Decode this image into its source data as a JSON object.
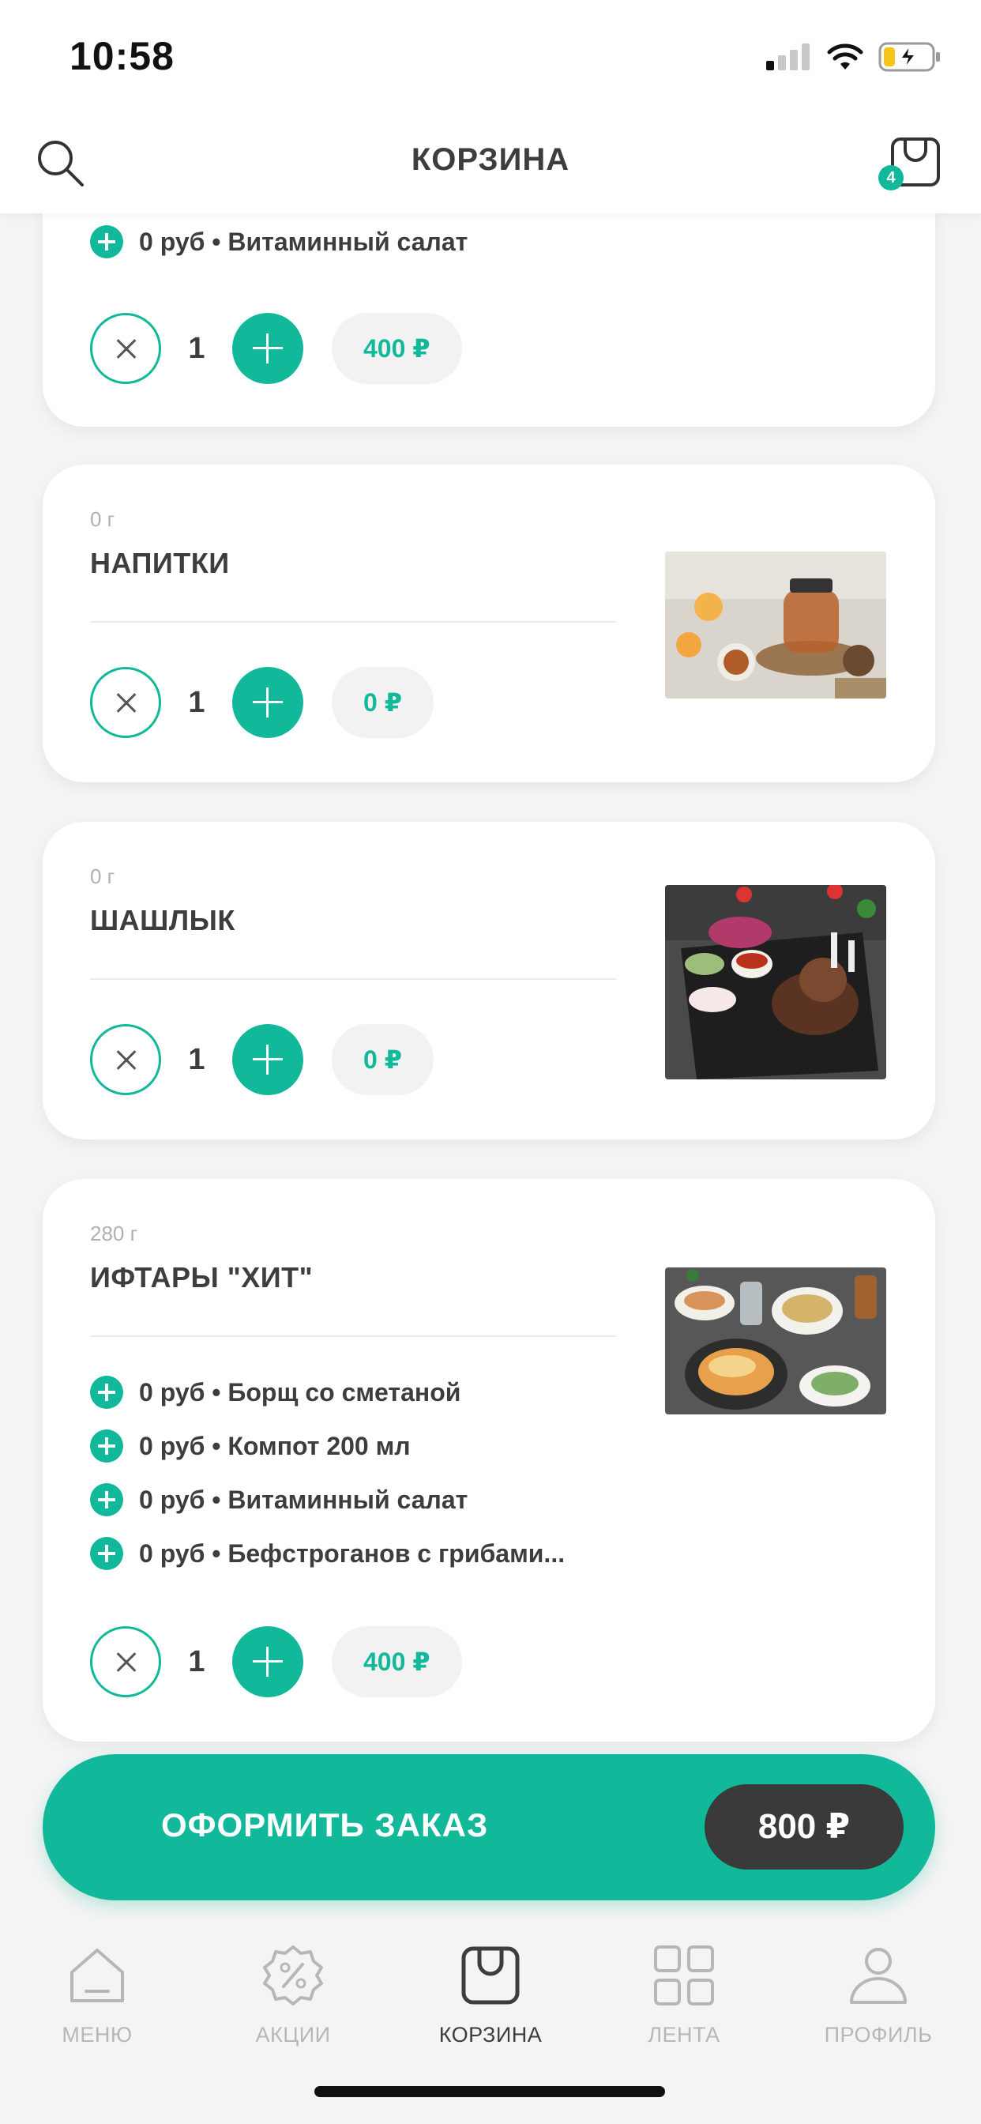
{
  "status_bar": {
    "time": "10:58"
  },
  "header": {
    "title": "КОРЗИНА",
    "cart_count": "4"
  },
  "cards": [
    {
      "modifiers": [
        "0 руб • Витаминный салат"
      ],
      "quantity": "1",
      "price": "400 ₽"
    },
    {
      "weight": "0 г",
      "name": "НАПИТКИ",
      "quantity": "1",
      "price": "0 ₽",
      "image": "tea-photo"
    },
    {
      "weight": "0 г",
      "name": "ШАШЛЫК",
      "quantity": "1",
      "price": "0 ₽",
      "image": "shashlik-photo"
    },
    {
      "weight": "280 г",
      "name": "ИФТАРЫ \"ХИТ\"",
      "modifiers": [
        "0 руб • Борщ со сметаной",
        "0 руб • Компот 200 мл",
        "0 руб • Витаминный салат",
        "0 руб • Бефстроганов с грибами..."
      ],
      "quantity": "1",
      "price": "400 ₽",
      "image": "iftar-photo"
    }
  ],
  "order": {
    "label": "ОФОРМИТЬ ЗАКАЗ",
    "total": "800 ₽"
  },
  "tabs": [
    {
      "label": "МЕНЮ",
      "icon": "home-icon"
    },
    {
      "label": "АКЦИИ",
      "icon": "discount-icon"
    },
    {
      "label": "КОРЗИНА",
      "icon": "bag-icon",
      "active": true
    },
    {
      "label": "ЛЕНТА",
      "icon": "grid-icon"
    },
    {
      "label": "ПРОФИЛЬ",
      "icon": "profile-icon"
    }
  ],
  "colors": {
    "accent": "#12b89a",
    "dark": "#3a3a3a",
    "inactive": "#b7b7b7"
  }
}
